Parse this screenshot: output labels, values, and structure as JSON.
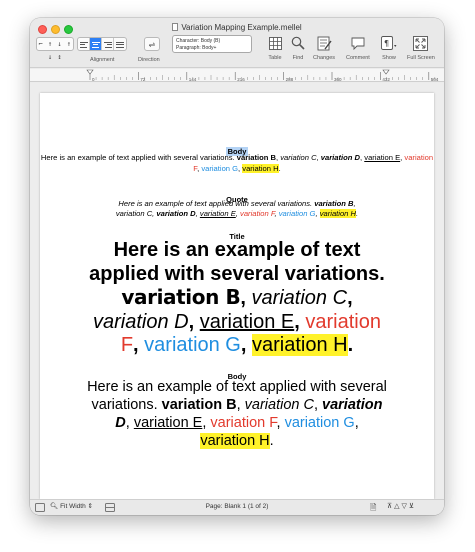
{
  "window": {
    "title": "Variation Mapping Example.mellel"
  },
  "toolbar": {
    "tab_stops_text": "⌐ ↑ ↓ ↑ ↓ ↕",
    "alignment_label": "Alignment",
    "direction_label": "Direction",
    "direction_icon": "⇌",
    "style_box": {
      "character": "Character: Body (B)",
      "paragraph": "Paragraph: Body+"
    },
    "table_label": "Table",
    "find_label": "Find",
    "changes_label": "Changes",
    "comment_label": "Comment",
    "show_label": "Show",
    "fullscreen_label": "Full Screen"
  },
  "ruler": {
    "numbers": [
      "0",
      "72",
      "144",
      "216",
      "288",
      "360",
      "432",
      "504"
    ]
  },
  "document": {
    "body_small": {
      "style_name": "Body",
      "intro": "Here is an example of text applied with several variations. ",
      "var_b": "variation B",
      "var_c": "variation C",
      "var_d": "variation D",
      "var_e": "variation E",
      "var_f": "variation F",
      "var_g": "variation G",
      "var_h": "variation H",
      "sep": ", ",
      "end": "."
    },
    "quote": {
      "style_name": "Quote"
    },
    "title": {
      "style_name": "Title"
    },
    "body_large": {
      "style_name": "Body"
    }
  },
  "colors": {
    "variation_f": "#e23a2d",
    "variation_g": "#1f8ee0",
    "variation_h_highlight": "#fff22a",
    "selection": "#b4d3f5",
    "accent": "#2c7ff5"
  },
  "statusbar": {
    "zoom": "Fit Width",
    "page_info": "Page: Blank 1 (1 of 2)"
  }
}
